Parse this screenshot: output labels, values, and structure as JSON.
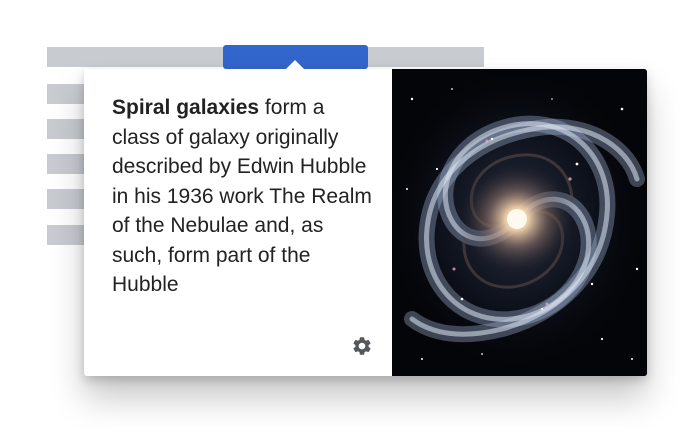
{
  "preview": {
    "title_bold": "Spiral galaxies",
    "extract_rest": " form a class of galaxy originally described by Edwin Hubble in his 1936 work The Realm of the Nebulae and, as such, form part of the Hubble",
    "image_subject": "spiral galaxy photograph",
    "settings_icon": "gear-icon"
  },
  "colors": {
    "link_highlight": "#3366cc",
    "placeholder_text_lines": "#c8ccd1",
    "text": "#222222",
    "image_background": "#040509"
  }
}
